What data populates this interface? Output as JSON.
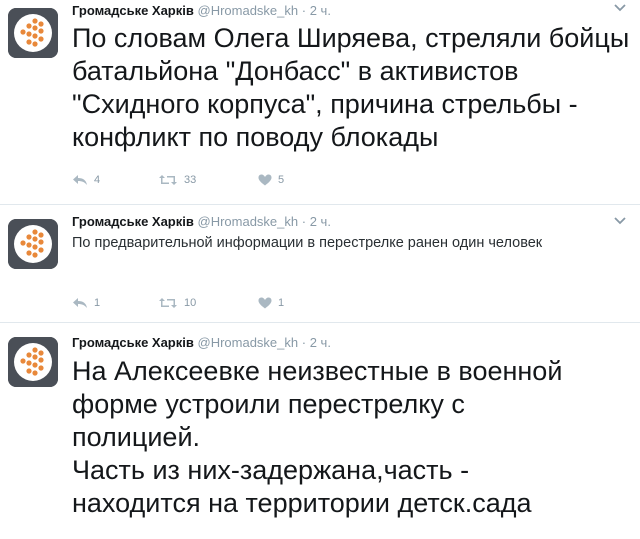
{
  "colors": {
    "text": "#14171a",
    "muted": "#8899a6",
    "border": "#e1e8ed",
    "avatar_bg": "#4a4f57",
    "avatar_dots": "#e8883a"
  },
  "icons": {
    "reply": "reply-icon",
    "retweet": "retweet-icon",
    "like": "heart-icon",
    "menu": "chevron-down-icon",
    "avatar": "avatar"
  },
  "tweets": [
    {
      "name": "Громадське Харків",
      "handle": "@Hromadske_kh",
      "sep": "·",
      "time": "2 ч.",
      "text": "По словам Олега Ширяева, стреляли бойцы батальйона \"Донбасс\" в активистов \"Схидного корпуса\", причина стрельбы - конфликт по поводу блокады",
      "replies": "4",
      "retweets": "33",
      "likes": "5"
    },
    {
      "name": "Громадське Харків",
      "handle": "@Hromadske_kh",
      "sep": "·",
      "time": "2 ч.",
      "text": "По предварительной информации в перестрелке ранен один человек",
      "replies": "1",
      "retweets": "10",
      "likes": "1"
    },
    {
      "name": "Громадське Харків",
      "handle": "@Hromadske_kh",
      "sep": "·",
      "time": "2 ч.",
      "text_lines": [
        "На Алексеевке неизвестные в военной",
        "форме устроили перестрелку с",
        "полицией.",
        "Часть из них-задержана,часть -",
        "находится на территории детск.сада"
      ]
    }
  ]
}
